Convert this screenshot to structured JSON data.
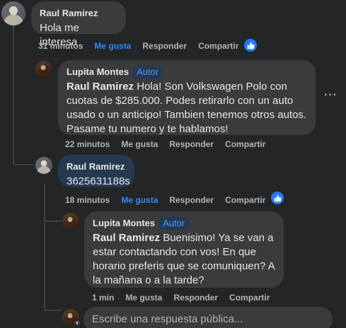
{
  "comments": [
    {
      "author": "Raul Ramirez",
      "text": "Hola me interesa",
      "time": "31 minutos",
      "like": "Me gusta",
      "reply": "Responder",
      "share": "Compartir"
    },
    {
      "author": "Lupita Montes",
      "badge": "Autor",
      "mention": "Raul Ramirez",
      "text": " Hola! Son Volkswagen Polo con cuotas de $285.000. Podes retirarlo con un auto usado o un anticipo! Tambien tenemos otros autos. Pasame tu numero y te hablamos!",
      "time": "22 minutos",
      "like": "Me gusta",
      "reply": "Responder",
      "share": "Compartir"
    },
    {
      "author": "Raul Ramirez",
      "text": "3625631188s",
      "time": "18 minutos",
      "like": "Me gusta",
      "reply": "Responder",
      "share": "Compartir"
    },
    {
      "author": "Lupita Montes",
      "badge": "Autor",
      "mention": "Raul Ramirez",
      "text": " Buenisimo! Ya se van a estar contactando con vos! En que horario preferis que se comuniquen? A la mañana o a la tarde?",
      "time": "1 min",
      "like": "Me gusta",
      "reply": "Responder",
      "share": "Compartir"
    }
  ],
  "reply_box": {
    "placeholder": "Escribe una respuesta pública..."
  },
  "icons": {
    "like": "thumbs-up-icon",
    "more": "more-options-icon",
    "caret": "chevron-down-icon"
  },
  "colors": {
    "background": "#242526",
    "bubble": "#3a3b3c",
    "highlight_bubble": "#263951",
    "accent": "#2d88ff",
    "secondary_text": "#b0b3b8"
  }
}
